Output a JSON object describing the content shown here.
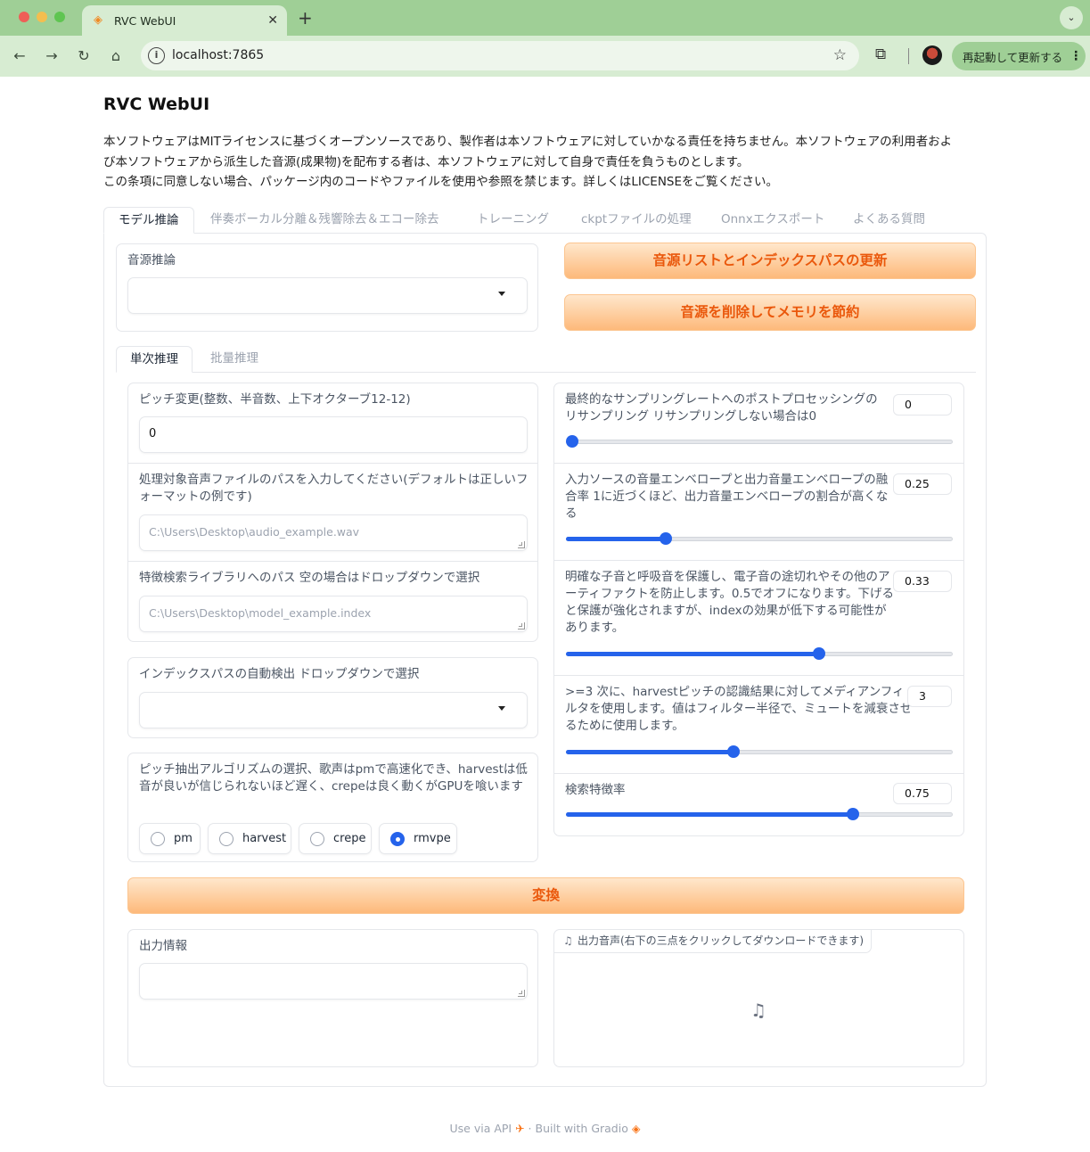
{
  "browser": {
    "tab_title": "RVC WebUI",
    "url": "localhost:7865",
    "relaunch_label": "再起動して更新する"
  },
  "app": {
    "title": "RVC WebUI",
    "notice_lines": [
      "本ソフトウェアはMITライセンスに基づくオープンソースであり、製作者は本ソフトウェアに対していかなる責任を持ちません。本ソフトウェアの利用者およ",
      "び本ソフトウェアから派生した音源(成果物)を配布する者は、本ソフトウェアに対して自身で責任を負うものとします。",
      "この条項に同意しない場合、パッケージ内のコードやファイルを使用や参照を禁じます。詳しくはLICENSEをご覧ください。"
    ]
  },
  "main_tabs": [
    {
      "label": "モデル推論",
      "active": true
    },
    {
      "label": "伴奏ボーカル分離＆残響除去＆エコー除去",
      "active": false
    },
    {
      "label": "トレーニング",
      "active": false
    },
    {
      "label": "ckptファイルの処理",
      "active": false
    },
    {
      "label": "Onnxエクスポート",
      "active": false
    },
    {
      "label": "よくある質問",
      "active": false
    }
  ],
  "model_inference": {
    "voice_label": "音源推論",
    "voice_value": "",
    "refresh_button": "音源リストとインデックスパスの更新",
    "unload_button": "音源を削除してメモリを節約"
  },
  "sub_tabs": [
    {
      "label": "単次推理",
      "active": true
    },
    {
      "label": "批量推理",
      "active": false
    }
  ],
  "single": {
    "pitch_label": "ピッチ変更(整数、半音数、上下オクターブ12-12)",
    "pitch_value": "0",
    "input_path_label": "処理対象音声ファイルのパスを入力してください(デフォルトは正しいフォーマットの例です)",
    "input_path_placeholder": "C:\\Users\\Desktop\\audio_example.wav",
    "index_path_label": "特徴検索ライブラリへのパス 空の場合はドロップダウンで選択",
    "index_path_placeholder": "C:\\Users\\Desktop\\model_example.index",
    "auto_index_label": "インデックスパスの自動検出 ドロップダウンで選択",
    "auto_index_value": "",
    "f0_label": "ピッチ抽出アルゴリズムの選択、歌声はpmで高速化でき、harvestは低音が良いが信じられないほど遅く、crepeは良く動くがGPUを喰います",
    "f0_options": [
      "pm",
      "harvest",
      "crepe",
      "rmvpe"
    ],
    "f0_selected": "rmvpe",
    "resample_label": "最終的なサンプリングレートへのポストプロセッシングのリサンプリング リサンプリングしない場合は0",
    "resample_value": "0",
    "resample_fraction": 0.0,
    "rms_label": "入力ソースの音量エンベロープと出力音量エンベロープの融合率 1に近づくほど、出力音量エンベロープの割合が高くなる",
    "rms_value": "0.25",
    "rms_fraction": 0.25,
    "protect_label": "明確な子音と呼吸音を保護し、電子音の途切れやその他のアーティファクトを防止します。0.5でオフになります。下げると保護が強化されますが、indexの効果が低下する可能性があります。",
    "protect_value": "0.33",
    "protect_fraction": 0.66,
    "filter_label": ">=3 次に、harvestピッチの認識結果に対してメディアンフィルタを使用します。値はフィルター半径で、ミュートを減衰させるために使用します。",
    "filter_value": "3",
    "filter_fraction": 0.43,
    "index_rate_label": "検索特徴率",
    "index_rate_value": "0.75",
    "index_rate_fraction": 0.75,
    "convert_button": "変換",
    "output_info_label": "出力情報",
    "output_info_value": "",
    "output_audio_label": "出力音声(右下の三点をクリックしてダウンロードできます)"
  },
  "footer": {
    "api": "Use via API",
    "separator": "·",
    "built": "Built with Gradio"
  }
}
